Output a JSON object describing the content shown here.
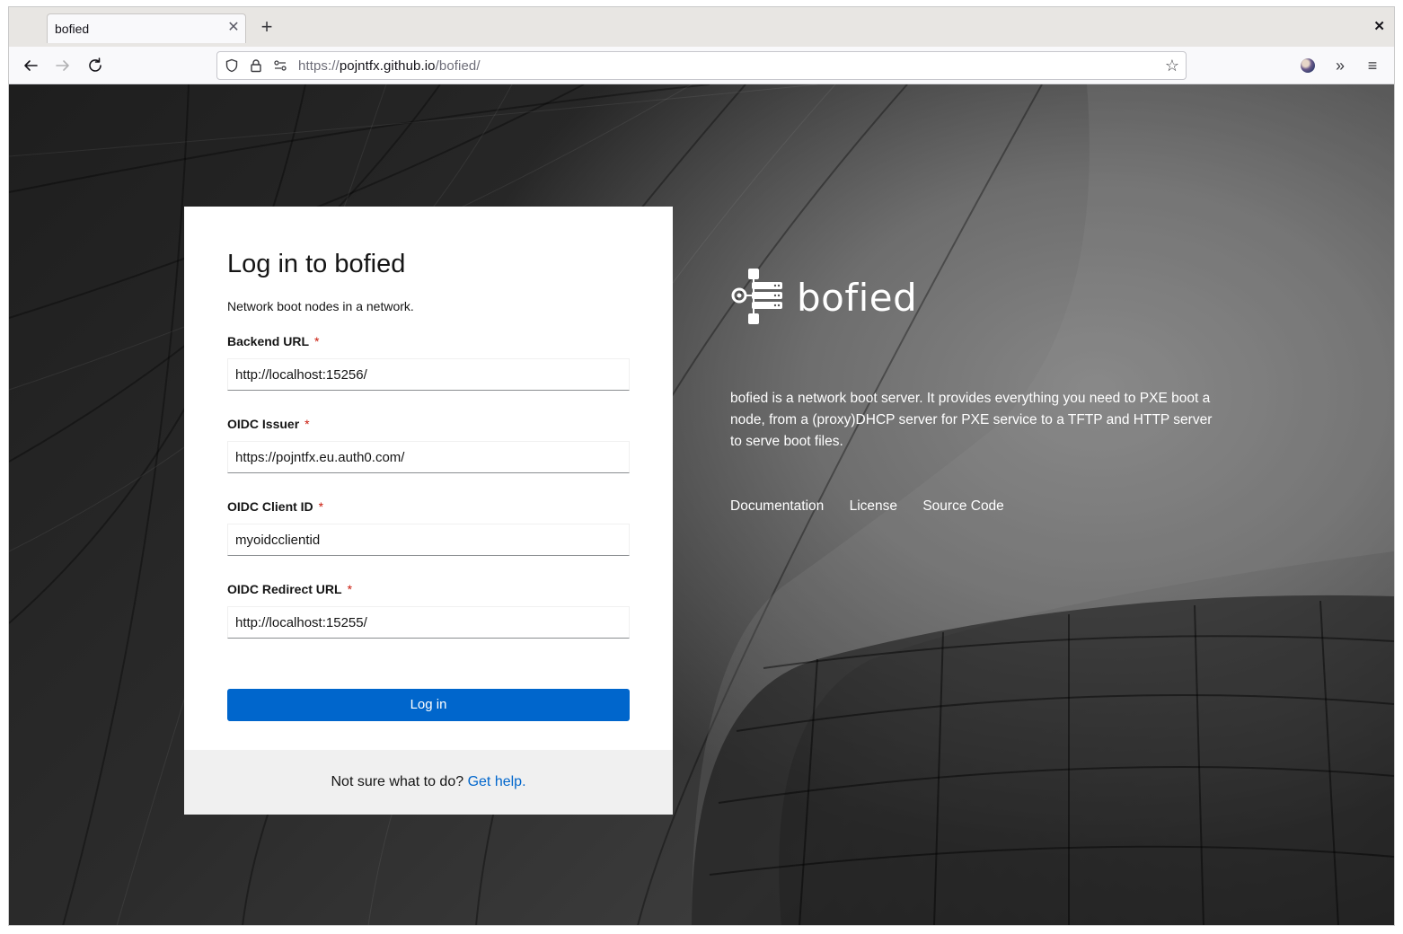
{
  "browser": {
    "tab_title": "bofied",
    "url_scheme": "https://",
    "url_host": "pojntfx.github.io",
    "url_path": "/bofied/"
  },
  "login": {
    "title": "Log in to bofied",
    "subtitle": "Network boot nodes in a network.",
    "fields": [
      {
        "label": "Backend URL",
        "value": "http://localhost:15256/"
      },
      {
        "label": "OIDC Issuer",
        "value": "https://pojntfx.eu.auth0.com/"
      },
      {
        "label": "OIDC Client ID",
        "value": "myoidcclientid"
      },
      {
        "label": "OIDC Redirect URL",
        "value": "http://localhost:15255/"
      }
    ],
    "required_marker": "*",
    "button": "Log in",
    "footer_text": "Not sure what to do?",
    "footer_link": "Get help."
  },
  "brand": {
    "name": "bofied",
    "description": "bofied is a network boot server. It provides everything you need to PXE boot a node, from a (proxy)DHCP server for PXE service to a TFTP and HTTP server to serve boot files.",
    "links": [
      "Documentation",
      "License",
      "Source Code"
    ]
  },
  "icons": {
    "back": "back-arrow-icon",
    "forward": "forward-arrow-icon",
    "reload": "reload-icon",
    "shield": "shield-icon",
    "lock": "lock-icon",
    "permissions": "permissions-icon",
    "star": "bookmark-star-icon",
    "overflow": "overflow-chevrons-icon",
    "menu": "hamburger-menu-icon"
  },
  "colors": {
    "primary": "#0066cc",
    "required": "#c9190b",
    "footer_bg": "#f0f0f0"
  }
}
